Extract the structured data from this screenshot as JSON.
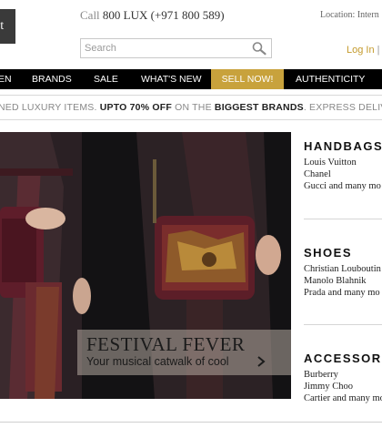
{
  "header": {
    "logo_text": "et",
    "call_prefix": "Call",
    "call_number": "800 LUX (+971 800 589)",
    "location_text": "Location: Intern",
    "search_placeholder": "Search",
    "login_label": "Log In",
    "login_separator": "| I"
  },
  "nav": {
    "items": [
      "EN",
      "BRANDS",
      "SALE",
      "WHAT'S NEW",
      "SELL NOW!",
      "AUTHENTICITY"
    ]
  },
  "promo": {
    "part1": "NED LUXURY ITEMS.",
    "part2": "UPTO 70% OFF",
    "part3": "ON THE",
    "part4": "BIGGEST BRANDS",
    "part5": ". EXPRESS DELIVERY!"
  },
  "hero": {
    "title": "FESTIVAL FEVER",
    "subtitle": "Your musical catwalk of cool"
  },
  "categories": [
    {
      "title": "HANDBAGS",
      "lines": [
        "Louis Vuitton",
        "Chanel",
        "Gucci and many mo"
      ]
    },
    {
      "title": "SHOES",
      "lines": [
        "Christian Louboutin",
        "Manolo Blahnik",
        "Prada and many mo"
      ]
    },
    {
      "title": "ACCESSORIES",
      "lines": [
        "Burberry",
        "Jimmy Choo",
        "Cartier and many mo"
      ]
    }
  ],
  "colors": {
    "accent_gold": "#c8a23c",
    "nav_bg": "#000000",
    "login_gold": "#c49a2c"
  }
}
